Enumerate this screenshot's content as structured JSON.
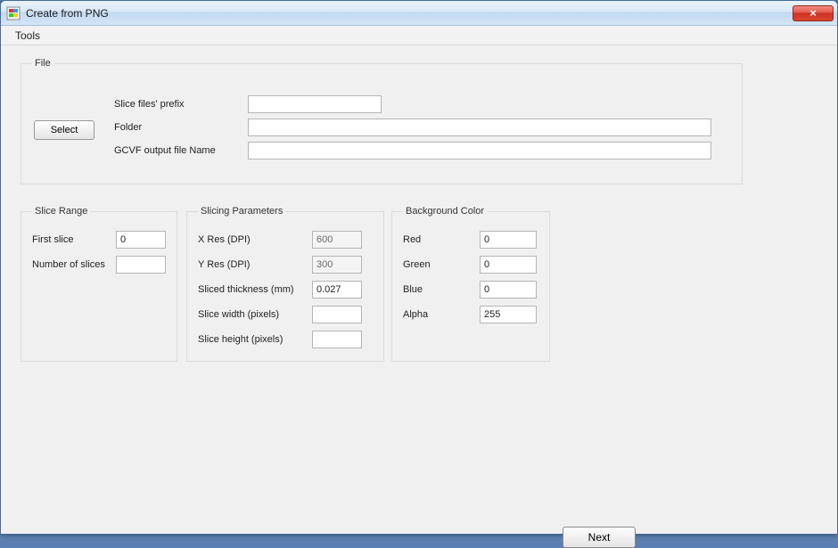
{
  "window": {
    "title": "Create from PNG"
  },
  "menu": {
    "tools": "Tools"
  },
  "file": {
    "legend": "File",
    "select_label": "Select",
    "prefix_label": "Slice files' prefix",
    "prefix_value": "",
    "folder_label": "Folder",
    "folder_value": "",
    "output_label": "GCVF output file Name",
    "output_value": ""
  },
  "range": {
    "legend": "Slice Range",
    "first_label": "First slice",
    "first_value": "0",
    "count_label": "Number of slices",
    "count_value": ""
  },
  "params": {
    "legend": "Slicing Parameters",
    "xres_label": "X Res (DPI)",
    "xres_value": "600",
    "yres_label": "Y Res (DPI)",
    "yres_value": "300",
    "thick_label": "Sliced thickness (mm)",
    "thick_value": "0.027",
    "width_label": "Slice width (pixels)",
    "width_value": "",
    "height_label": "Slice height (pixels)",
    "height_value": ""
  },
  "bg": {
    "legend": "Background Color",
    "red_label": "Red",
    "red_value": "0",
    "green_label": "Green",
    "green_value": "0",
    "blue_label": "Blue",
    "blue_value": "0",
    "alpha_label": "Alpha",
    "alpha_value": "255"
  },
  "footer": {
    "next_label": "Next"
  }
}
